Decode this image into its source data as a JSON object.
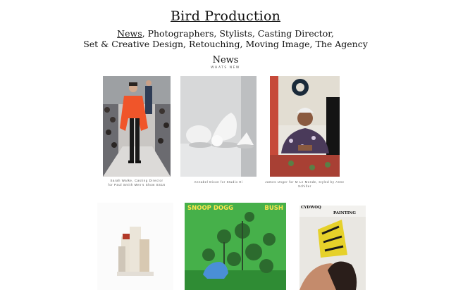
{
  "brand": "Bird Production",
  "nav": {
    "line1": [
      {
        "label": "News",
        "sep": ", "
      },
      {
        "label": "Photographers",
        "sep": ", "
      },
      {
        "label": "Stylists",
        "sep": ", "
      },
      {
        "label": "Casting Director",
        "sep": ","
      }
    ],
    "line2": [
      {
        "label": "Set & Creative Design",
        "sep": ", "
      },
      {
        "label": "Retouching",
        "sep": ", "
      },
      {
        "label": "Moving Image",
        "sep": ", "
      },
      {
        "label": "The Agency",
        "sep": ""
      }
    ],
    "active": "News"
  },
  "section": {
    "title": "News",
    "subtitle": "WHATS NEW"
  },
  "row1": [
    {
      "caption": "Sarah Walke, Casting Director\nfor Paul Smith Men's Show SS16"
    },
    {
      "caption": "Annabel Dixon for Studio Hi"
    },
    {
      "caption": "James Unger for M Le Monde, styled by Anne Schiller"
    }
  ],
  "row2": {
    "album": {
      "left": "SNOOP DOGG",
      "right": "BUSH"
    },
    "magazine": {
      "masthead": "CYDWOQ",
      "title": "PAINTING"
    }
  }
}
